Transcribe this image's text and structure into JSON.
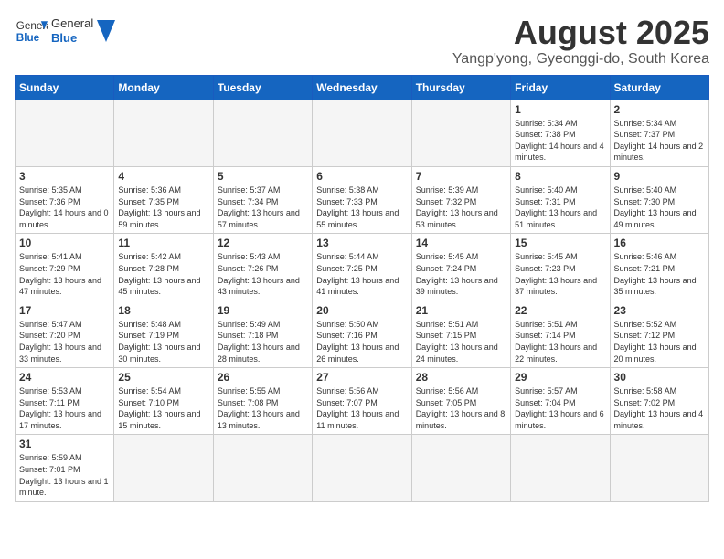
{
  "header": {
    "logo_general": "General",
    "logo_blue": "Blue",
    "month_title": "August 2025",
    "location": "Yangp'yong, Gyeonggi-do, South Korea"
  },
  "weekdays": [
    "Sunday",
    "Monday",
    "Tuesday",
    "Wednesday",
    "Thursday",
    "Friday",
    "Saturday"
  ],
  "weeks": [
    [
      {
        "day": "",
        "info": ""
      },
      {
        "day": "",
        "info": ""
      },
      {
        "day": "",
        "info": ""
      },
      {
        "day": "",
        "info": ""
      },
      {
        "day": "",
        "info": ""
      },
      {
        "day": "1",
        "info": "Sunrise: 5:34 AM\nSunset: 7:38 PM\nDaylight: 14 hours and 4 minutes."
      },
      {
        "day": "2",
        "info": "Sunrise: 5:34 AM\nSunset: 7:37 PM\nDaylight: 14 hours and 2 minutes."
      }
    ],
    [
      {
        "day": "3",
        "info": "Sunrise: 5:35 AM\nSunset: 7:36 PM\nDaylight: 14 hours and 0 minutes."
      },
      {
        "day": "4",
        "info": "Sunrise: 5:36 AM\nSunset: 7:35 PM\nDaylight: 13 hours and 59 minutes."
      },
      {
        "day": "5",
        "info": "Sunrise: 5:37 AM\nSunset: 7:34 PM\nDaylight: 13 hours and 57 minutes."
      },
      {
        "day": "6",
        "info": "Sunrise: 5:38 AM\nSunset: 7:33 PM\nDaylight: 13 hours and 55 minutes."
      },
      {
        "day": "7",
        "info": "Sunrise: 5:39 AM\nSunset: 7:32 PM\nDaylight: 13 hours and 53 minutes."
      },
      {
        "day": "8",
        "info": "Sunrise: 5:40 AM\nSunset: 7:31 PM\nDaylight: 13 hours and 51 minutes."
      },
      {
        "day": "9",
        "info": "Sunrise: 5:40 AM\nSunset: 7:30 PM\nDaylight: 13 hours and 49 minutes."
      }
    ],
    [
      {
        "day": "10",
        "info": "Sunrise: 5:41 AM\nSunset: 7:29 PM\nDaylight: 13 hours and 47 minutes."
      },
      {
        "day": "11",
        "info": "Sunrise: 5:42 AM\nSunset: 7:28 PM\nDaylight: 13 hours and 45 minutes."
      },
      {
        "day": "12",
        "info": "Sunrise: 5:43 AM\nSunset: 7:26 PM\nDaylight: 13 hours and 43 minutes."
      },
      {
        "day": "13",
        "info": "Sunrise: 5:44 AM\nSunset: 7:25 PM\nDaylight: 13 hours and 41 minutes."
      },
      {
        "day": "14",
        "info": "Sunrise: 5:45 AM\nSunset: 7:24 PM\nDaylight: 13 hours and 39 minutes."
      },
      {
        "day": "15",
        "info": "Sunrise: 5:45 AM\nSunset: 7:23 PM\nDaylight: 13 hours and 37 minutes."
      },
      {
        "day": "16",
        "info": "Sunrise: 5:46 AM\nSunset: 7:21 PM\nDaylight: 13 hours and 35 minutes."
      }
    ],
    [
      {
        "day": "17",
        "info": "Sunrise: 5:47 AM\nSunset: 7:20 PM\nDaylight: 13 hours and 33 minutes."
      },
      {
        "day": "18",
        "info": "Sunrise: 5:48 AM\nSunset: 7:19 PM\nDaylight: 13 hours and 30 minutes."
      },
      {
        "day": "19",
        "info": "Sunrise: 5:49 AM\nSunset: 7:18 PM\nDaylight: 13 hours and 28 minutes."
      },
      {
        "day": "20",
        "info": "Sunrise: 5:50 AM\nSunset: 7:16 PM\nDaylight: 13 hours and 26 minutes."
      },
      {
        "day": "21",
        "info": "Sunrise: 5:51 AM\nSunset: 7:15 PM\nDaylight: 13 hours and 24 minutes."
      },
      {
        "day": "22",
        "info": "Sunrise: 5:51 AM\nSunset: 7:14 PM\nDaylight: 13 hours and 22 minutes."
      },
      {
        "day": "23",
        "info": "Sunrise: 5:52 AM\nSunset: 7:12 PM\nDaylight: 13 hours and 20 minutes."
      }
    ],
    [
      {
        "day": "24",
        "info": "Sunrise: 5:53 AM\nSunset: 7:11 PM\nDaylight: 13 hours and 17 minutes."
      },
      {
        "day": "25",
        "info": "Sunrise: 5:54 AM\nSunset: 7:10 PM\nDaylight: 13 hours and 15 minutes."
      },
      {
        "day": "26",
        "info": "Sunrise: 5:55 AM\nSunset: 7:08 PM\nDaylight: 13 hours and 13 minutes."
      },
      {
        "day": "27",
        "info": "Sunrise: 5:56 AM\nSunset: 7:07 PM\nDaylight: 13 hours and 11 minutes."
      },
      {
        "day": "28",
        "info": "Sunrise: 5:56 AM\nSunset: 7:05 PM\nDaylight: 13 hours and 8 minutes."
      },
      {
        "day": "29",
        "info": "Sunrise: 5:57 AM\nSunset: 7:04 PM\nDaylight: 13 hours and 6 minutes."
      },
      {
        "day": "30",
        "info": "Sunrise: 5:58 AM\nSunset: 7:02 PM\nDaylight: 13 hours and 4 minutes."
      }
    ],
    [
      {
        "day": "31",
        "info": "Sunrise: 5:59 AM\nSunset: 7:01 PM\nDaylight: 13 hours and 1 minute."
      },
      {
        "day": "",
        "info": ""
      },
      {
        "day": "",
        "info": ""
      },
      {
        "day": "",
        "info": ""
      },
      {
        "day": "",
        "info": ""
      },
      {
        "day": "",
        "info": ""
      },
      {
        "day": "",
        "info": ""
      }
    ]
  ]
}
